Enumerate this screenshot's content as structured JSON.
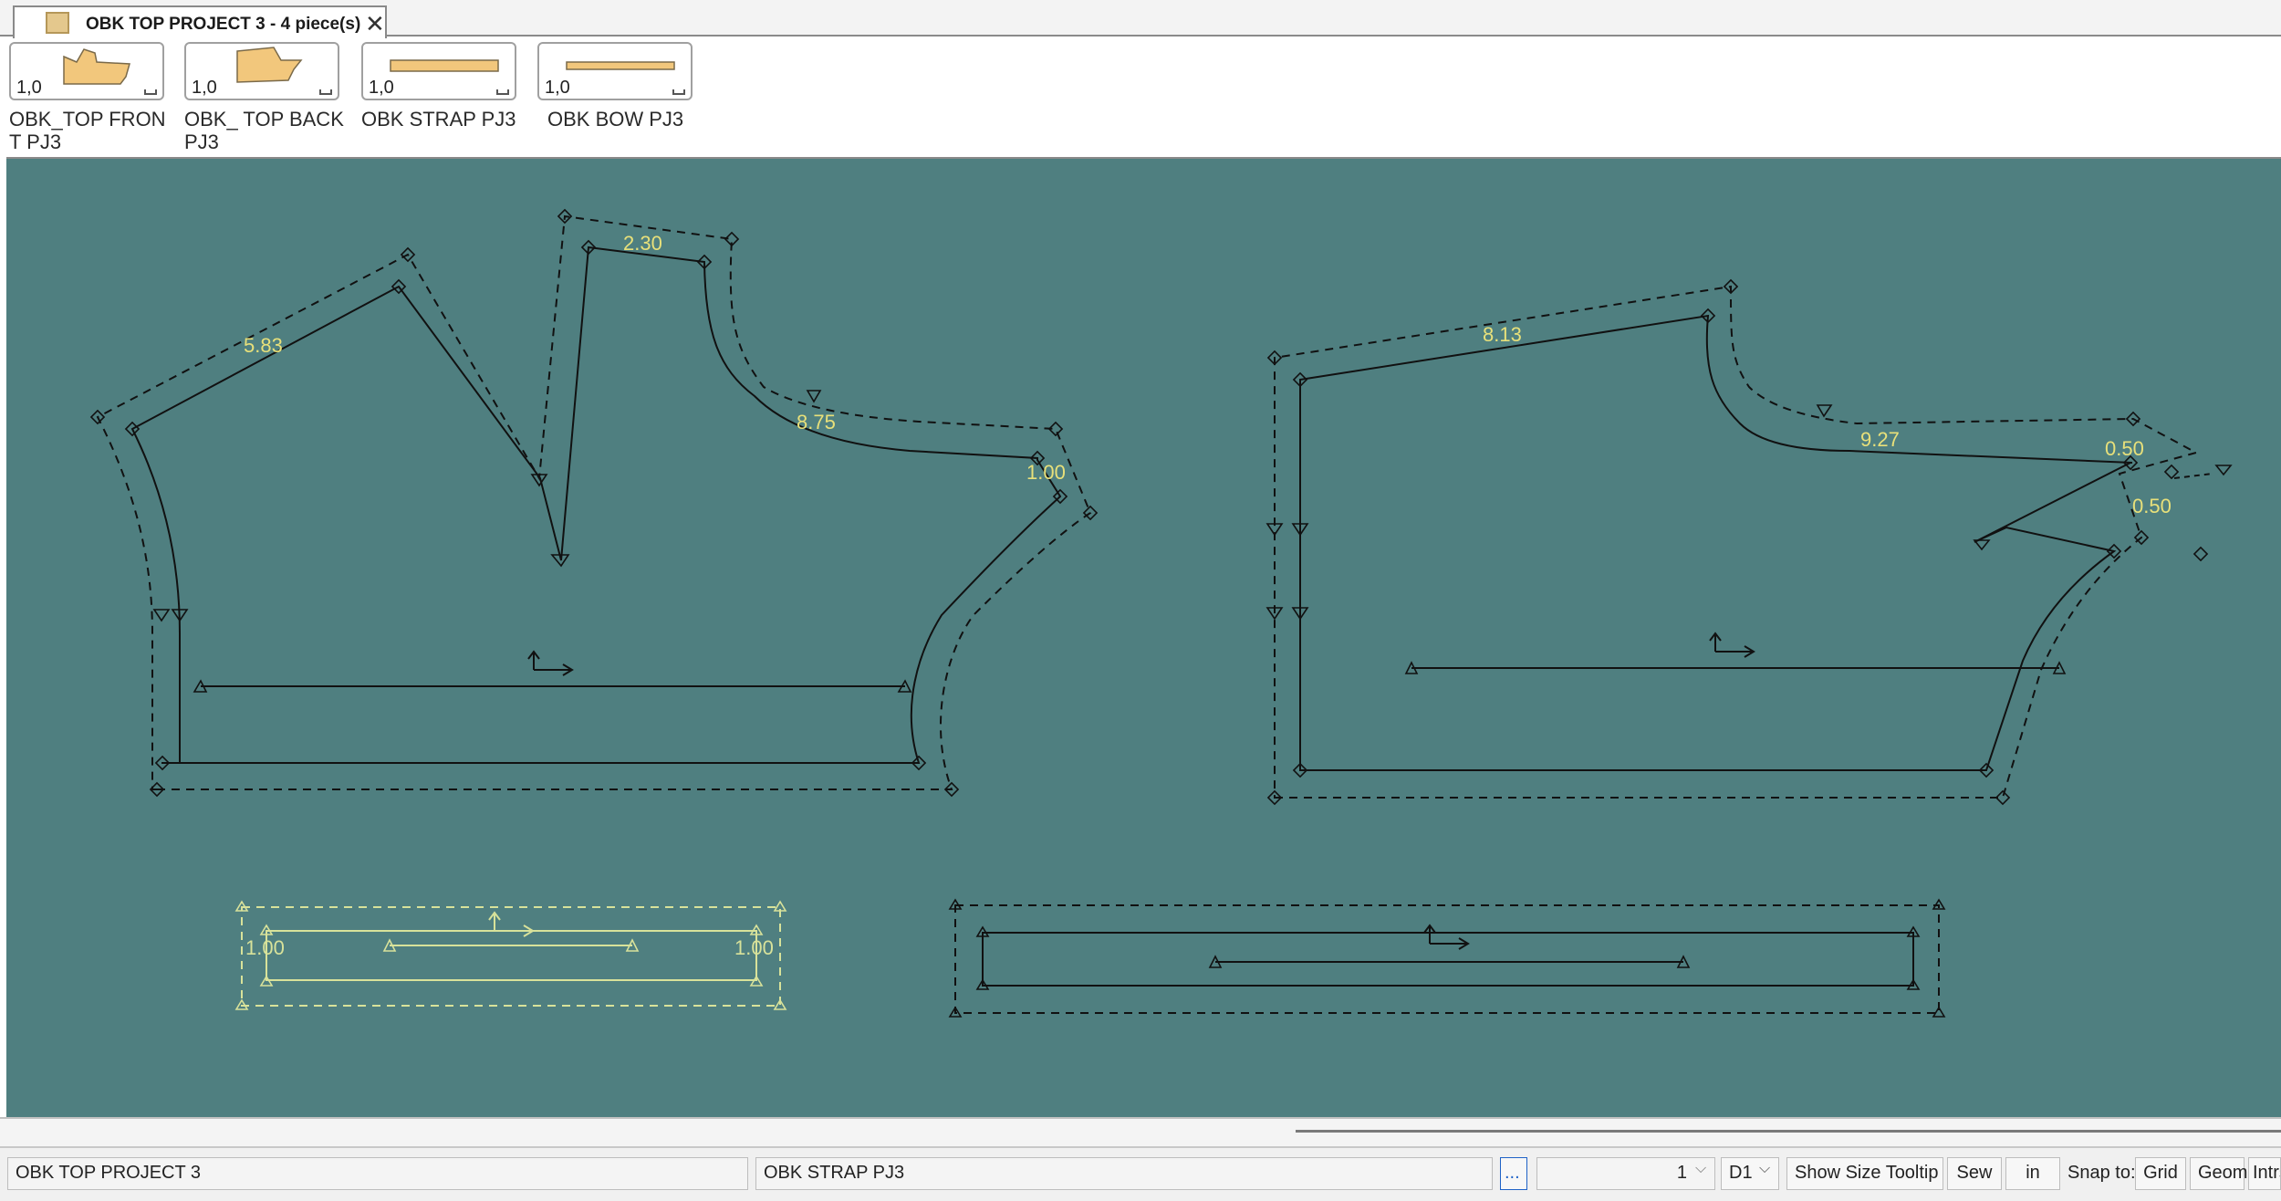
{
  "tab": {
    "title": "OBK TOP PROJECT 3  -  4 piece(s)",
    "close": "✕"
  },
  "pieces": [
    {
      "scale": "1,0",
      "name": "OBK_TOP FRON T PJ3"
    },
    {
      "scale": "1,0",
      "name": "OBK_ TOP BACK PJ3"
    },
    {
      "scale": "1,0",
      "name": "OBK STRAP PJ3"
    },
    {
      "scale": "1,0",
      "name": "OBK BOW PJ3"
    }
  ],
  "canvas": {
    "background": "#4f7f80",
    "front_labels": [
      "5.83",
      "2.30",
      "8.75",
      "1.00"
    ],
    "back_labels": [
      "8.13",
      "9.27",
      "0.50",
      "0.50"
    ],
    "strap_labels": [
      "1.00",
      "1.00"
    ]
  },
  "status": {
    "project": "OBK TOP PROJECT 3",
    "selected_piece": "OBK STRAP PJ3",
    "ellipsis": "...",
    "quantity": "1",
    "size": "D1",
    "show_size_tooltip": "Show Size Tooltip",
    "sew": "Sew",
    "unit": "in",
    "snap_to": "Snap to:",
    "grid": "Grid",
    "geom": "Geom",
    "intrs": "Intrs"
  }
}
